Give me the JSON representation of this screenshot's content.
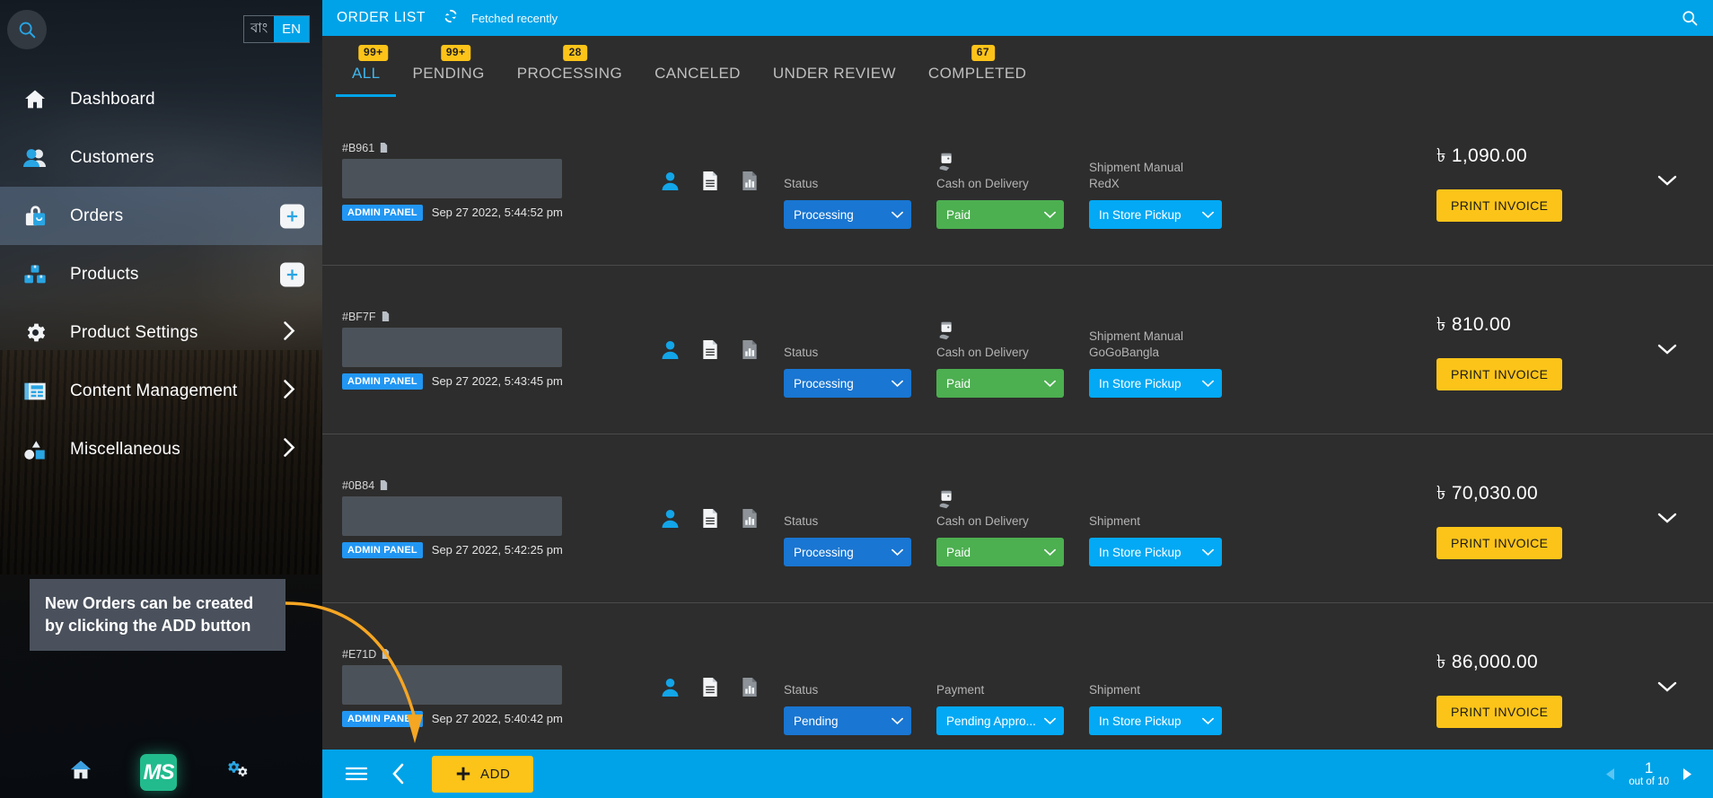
{
  "sidebar": {
    "search_icon": "search-icon",
    "language": {
      "options": [
        "বাং",
        "EN"
      ],
      "selected": "EN"
    },
    "items": [
      {
        "label": "Dashboard",
        "icon": "home-icon",
        "active": false,
        "chevron": false,
        "plus": false
      },
      {
        "label": "Customers",
        "icon": "users-icon",
        "active": false,
        "chevron": false,
        "plus": false
      },
      {
        "label": "Orders",
        "icon": "bag-icon",
        "active": true,
        "chevron": false,
        "plus": true
      },
      {
        "label": "Products",
        "icon": "boxes-icon",
        "active": false,
        "chevron": false,
        "plus": true
      },
      {
        "label": "Product Settings",
        "icon": "gear-icon",
        "active": false,
        "chevron": true,
        "plus": false
      },
      {
        "label": "Content Management",
        "icon": "newspaper-icon",
        "active": false,
        "chevron": true,
        "plus": false
      },
      {
        "label": "Miscellaneous",
        "icon": "shapes-icon",
        "active": false,
        "chevron": true,
        "plus": false
      }
    ],
    "tooltip": "New Orders can be created by clicking the ADD button",
    "footer": {
      "home_icon": "home-icon",
      "logo_text": "MS",
      "settings_icon": "gears-icon"
    }
  },
  "header": {
    "title": "ORDER LIST",
    "refresh_icon": "refresh-icon",
    "status": "Fetched recently",
    "search_icon": "search-icon"
  },
  "tabs": [
    {
      "label": "ALL",
      "badge": "99+",
      "active": true
    },
    {
      "label": "PENDING",
      "badge": "99+",
      "active": false
    },
    {
      "label": "PROCESSING",
      "badge": "28",
      "active": false
    },
    {
      "label": "CANCELED",
      "badge": "",
      "active": false
    },
    {
      "label": "UNDER REVIEW",
      "badge": "",
      "active": false
    },
    {
      "label": "COMPLETED",
      "badge": "67",
      "active": false
    }
  ],
  "orders": [
    {
      "id": "#B961",
      "source_badge": "ADMIN PANEL",
      "date": "Sep 27 2022, 5:44:52 pm",
      "status_label": "Status",
      "status_value": "Processing",
      "payment_label": "Cash on Delivery",
      "payment_icon": "cash-on-delivery-icon",
      "payment_value": "Paid",
      "payment_color": "green",
      "shipment_label": "Shipment Manual\nRedX",
      "shipment_value": "In Store Pickup",
      "amount": "৳ 1,090.00",
      "print_label": "PRINT INVOICE"
    },
    {
      "id": "#BF7F",
      "source_badge": "ADMIN PANEL",
      "date": "Sep 27 2022, 5:43:45 pm",
      "status_label": "Status",
      "status_value": "Processing",
      "payment_label": "Cash on Delivery",
      "payment_icon": "cash-on-delivery-icon",
      "payment_value": "Paid",
      "payment_color": "green",
      "shipment_label": "Shipment Manual\nGoGoBangla",
      "shipment_value": "In Store Pickup",
      "amount": "৳ 810.00",
      "print_label": "PRINT INVOICE"
    },
    {
      "id": "#0B84",
      "source_badge": "ADMIN PANEL",
      "date": "Sep 27 2022, 5:42:25 pm",
      "status_label": "Status",
      "status_value": "Processing",
      "payment_label": "Cash on Delivery",
      "payment_icon": "cash-on-delivery-icon",
      "payment_value": "Paid",
      "payment_color": "green",
      "shipment_label": "Shipment",
      "shipment_value": "In Store Pickup",
      "amount": "৳ 70,030.00",
      "print_label": "PRINT INVOICE"
    },
    {
      "id": "#E71D",
      "source_badge": "ADMIN PANEL",
      "date": "Sep 27 2022, 5:40:42 pm",
      "status_label": "Status",
      "status_value": "Pending",
      "payment_label": "Payment",
      "payment_icon": "",
      "payment_value": "Pending Appro...",
      "payment_color": "cyan",
      "shipment_label": "Shipment",
      "shipment_value": "In Store Pickup",
      "amount": "৳ 86,000.00",
      "print_label": "PRINT INVOICE"
    }
  ],
  "row_icons": [
    "customer-icon",
    "document-icon",
    "report-icon"
  ],
  "bottombar": {
    "menu_icon": "hamburger-icon",
    "back_icon": "chevron-left-icon",
    "add_label": "ADD",
    "pagination": {
      "prev_icon": "triangle-left-icon",
      "page": "1",
      "of_text": "out of 10",
      "next_icon": "triangle-right-icon"
    }
  },
  "colors": {
    "accent_blue": "#00a3e8",
    "accent_yellow": "#fcc419",
    "status_blue": "#1976d2",
    "paid_green": "#4caf50",
    "ship_cyan": "#03a9f4",
    "panel_dark": "#2d2d2d"
  }
}
